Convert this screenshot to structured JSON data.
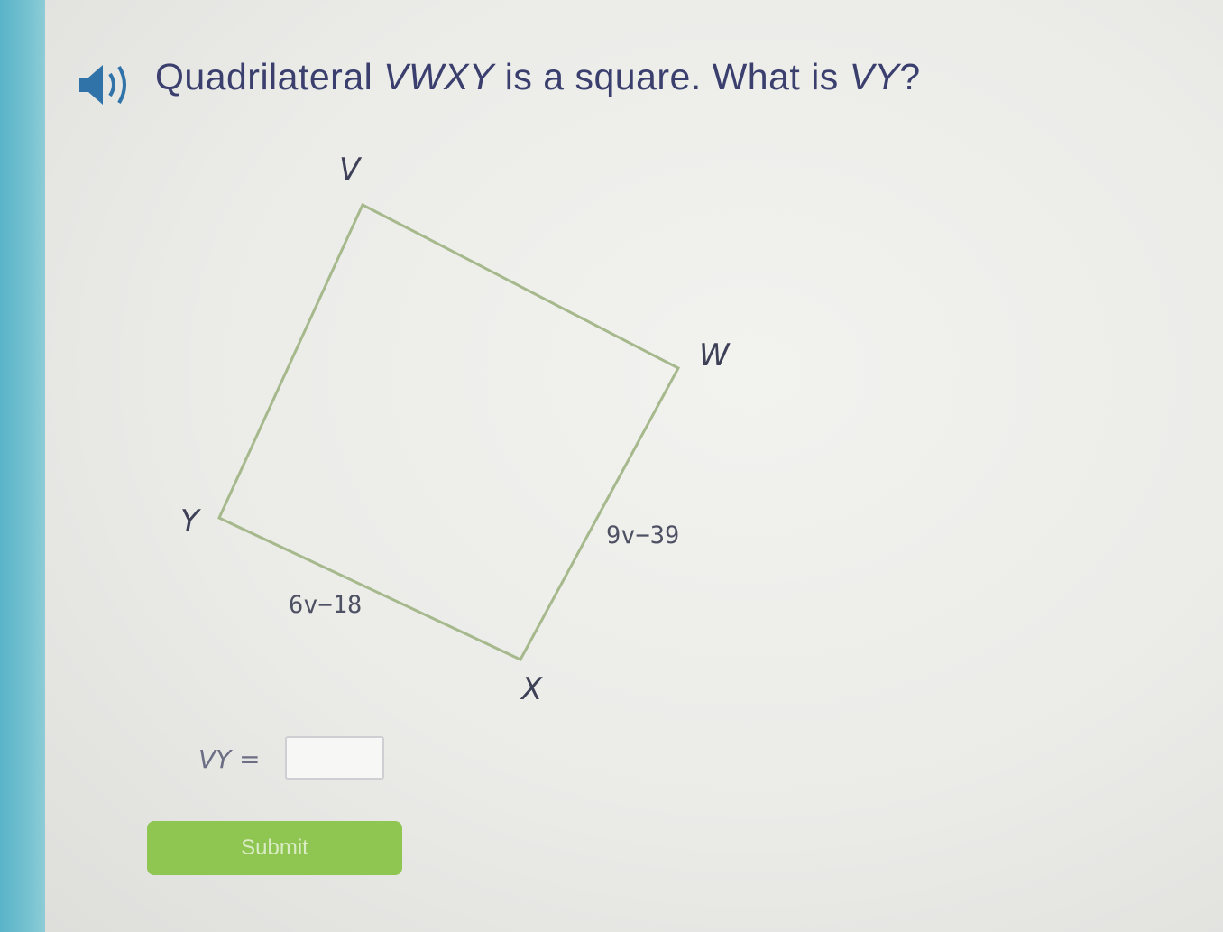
{
  "question": {
    "prefix": "Quadrilateral ",
    "shape_name": "VWXY",
    "middle": " is a square. What is ",
    "target": "VY",
    "suffix": "?"
  },
  "diagram": {
    "vertices": {
      "v": "V",
      "w": "W",
      "x": "X",
      "y": "Y"
    },
    "edge_labels": {
      "xy": "6v−18",
      "wx": "9v−39"
    }
  },
  "answer": {
    "label_var": "VY",
    "label_eq": " =",
    "value": ""
  },
  "submit": {
    "label": "Submit"
  },
  "colors": {
    "accent_stripe": "#5ab3c8",
    "question_text": "#3a3f6e",
    "square_stroke": "#a6b98c",
    "submit_bg": "#8fc551"
  },
  "icons": {
    "audio": "speaker-icon"
  }
}
